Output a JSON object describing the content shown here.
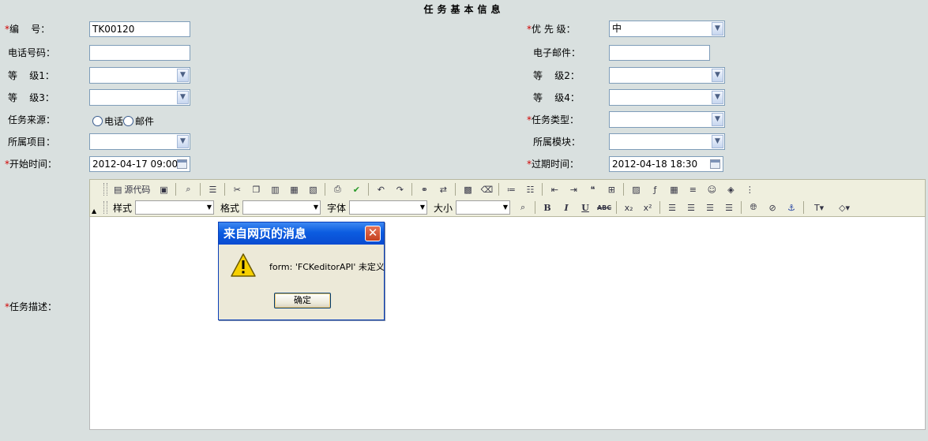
{
  "title": "任务基本信息",
  "fields": {
    "id": {
      "label": "编    号：",
      "value": "TK00120"
    },
    "priority": {
      "label": "优 先 级：",
      "value": "中"
    },
    "phone": {
      "label": "电话号码：",
      "value": ""
    },
    "email": {
      "label": "电子邮件：",
      "value": ""
    },
    "level1": {
      "label": "等    级1：",
      "value": ""
    },
    "level2": {
      "label": "等    级2：",
      "value": ""
    },
    "level3": {
      "label": "等    级3：",
      "value": ""
    },
    "level4": {
      "label": "等    级4：",
      "value": ""
    },
    "source": {
      "label": "任务来源：",
      "options": [
        "电话",
        "邮件"
      ]
    },
    "task_type": {
      "label": "任务类型：",
      "value": ""
    },
    "project": {
      "label": "所属项目：",
      "value": ""
    },
    "module": {
      "label": "所属模块：",
      "value": ""
    },
    "start_time": {
      "label": "开始时间：",
      "value": "2012-04-17 09:00"
    },
    "due_time": {
      "label": "过期时间：",
      "value": "2012-04-18 18:30"
    },
    "description": {
      "label": "任务描述："
    }
  },
  "required_mark": "*",
  "toolbar": {
    "source_label": "源代码",
    "style_label": "样式",
    "format_label": "格式",
    "font_label": "字体",
    "size_label": "大小",
    "bold": "B",
    "italic": "I",
    "underline": "U",
    "strike": "ABC"
  },
  "dialog": {
    "title": "来自网页的消息",
    "message": "form: 'FCKeditorAPI' 未定义",
    "ok_label": "确定"
  },
  "colors": {
    "background": "#d9e0df",
    "required": "#d00000",
    "dialog_title": "#0b5ce0"
  }
}
